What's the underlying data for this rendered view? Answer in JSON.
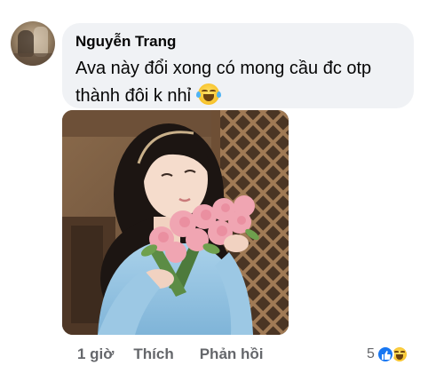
{
  "comment": {
    "author": "Nguyễn Trang",
    "text": "Ava này đổi xong có mong cầu đc otp thành đôi k nhỉ",
    "emoji": "laughing-tears-emoji"
  },
  "actions": {
    "time": "1 giờ",
    "like": "Thích",
    "reply": "Phản hồi"
  },
  "reactions": {
    "count": "5",
    "types": [
      "like",
      "haha"
    ]
  },
  "colors": {
    "bubble": "#f0f2f5",
    "secondary_text": "#65676b",
    "like_blue": "#1877f2"
  }
}
